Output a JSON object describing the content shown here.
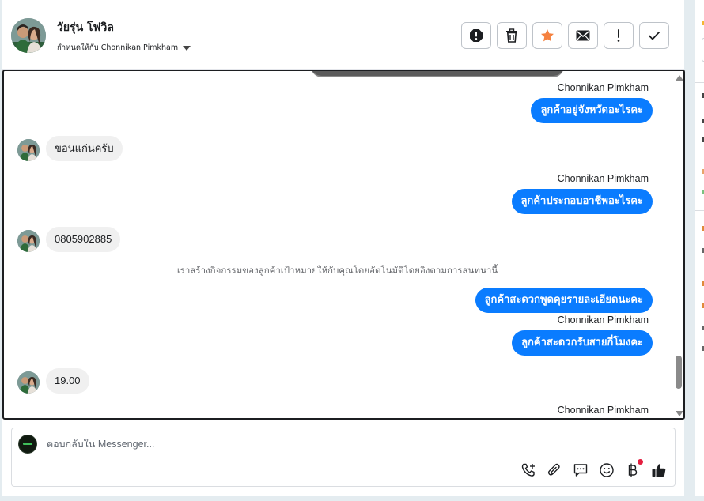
{
  "header": {
    "contact_name": "วัยรุ่น โฟวิล",
    "assigned_label": "กำหนดให้กับ Chonnikan Pimkham",
    "actions": [
      {
        "name": "mark-spam-button",
        "icon": "alert-octagon-icon"
      },
      {
        "name": "delete-button",
        "icon": "trash-icon"
      },
      {
        "name": "star-button",
        "icon": "star-icon",
        "color": "#f5813f"
      },
      {
        "name": "mark-unread-button",
        "icon": "envelope-icon"
      },
      {
        "name": "follow-up-button",
        "icon": "exclamation-icon"
      },
      {
        "name": "mark-done-button",
        "icon": "check-icon"
      }
    ]
  },
  "chat": {
    "agent_name": "Chonnikan Pimkham",
    "messages": [
      {
        "direction": "out",
        "sender": "Chonnikan Pimkham",
        "text": "ลูกค้าอยู่จังหวัดอะไรคะ"
      },
      {
        "direction": "in",
        "text": "ขอนแก่นครับ"
      },
      {
        "direction": "out",
        "sender": "Chonnikan Pimkham",
        "text": "ลูกค้าประกอบอาชีพอะไรคะ"
      },
      {
        "direction": "in",
        "text": "0805902885"
      },
      {
        "direction": "system",
        "text": "เราสร้างกิจกรรมของลูกค้าเป้าหมายให้กับคุณโดยอัตโนมัติโดยอิงตามการสนทนานี้"
      },
      {
        "direction": "out",
        "text": "ลูกค้าสะดวกพูดคุยรายละเอียดนะคะ"
      },
      {
        "direction": "out",
        "sender": "Chonnikan Pimkham",
        "text": "ลูกค้าสะดวกรับสายกี่โมงคะ"
      },
      {
        "direction": "in",
        "text": "19.00"
      },
      {
        "direction": "out-sender-only",
        "sender": "Chonnikan Pimkham"
      }
    ]
  },
  "composer": {
    "placeholder": "ตอบกลับใน Messenger...",
    "tools": [
      "phone-plus-icon",
      "paperclip-icon",
      "saved-reply-icon",
      "emoji-icon",
      "baht-icon",
      "thumbs-up-icon"
    ]
  },
  "colors": {
    "outgoing_bubble": "#0a7cff",
    "incoming_bubble": "#f0f0f0",
    "star": "#f5813f",
    "notification_dot": "#e41e3f"
  }
}
